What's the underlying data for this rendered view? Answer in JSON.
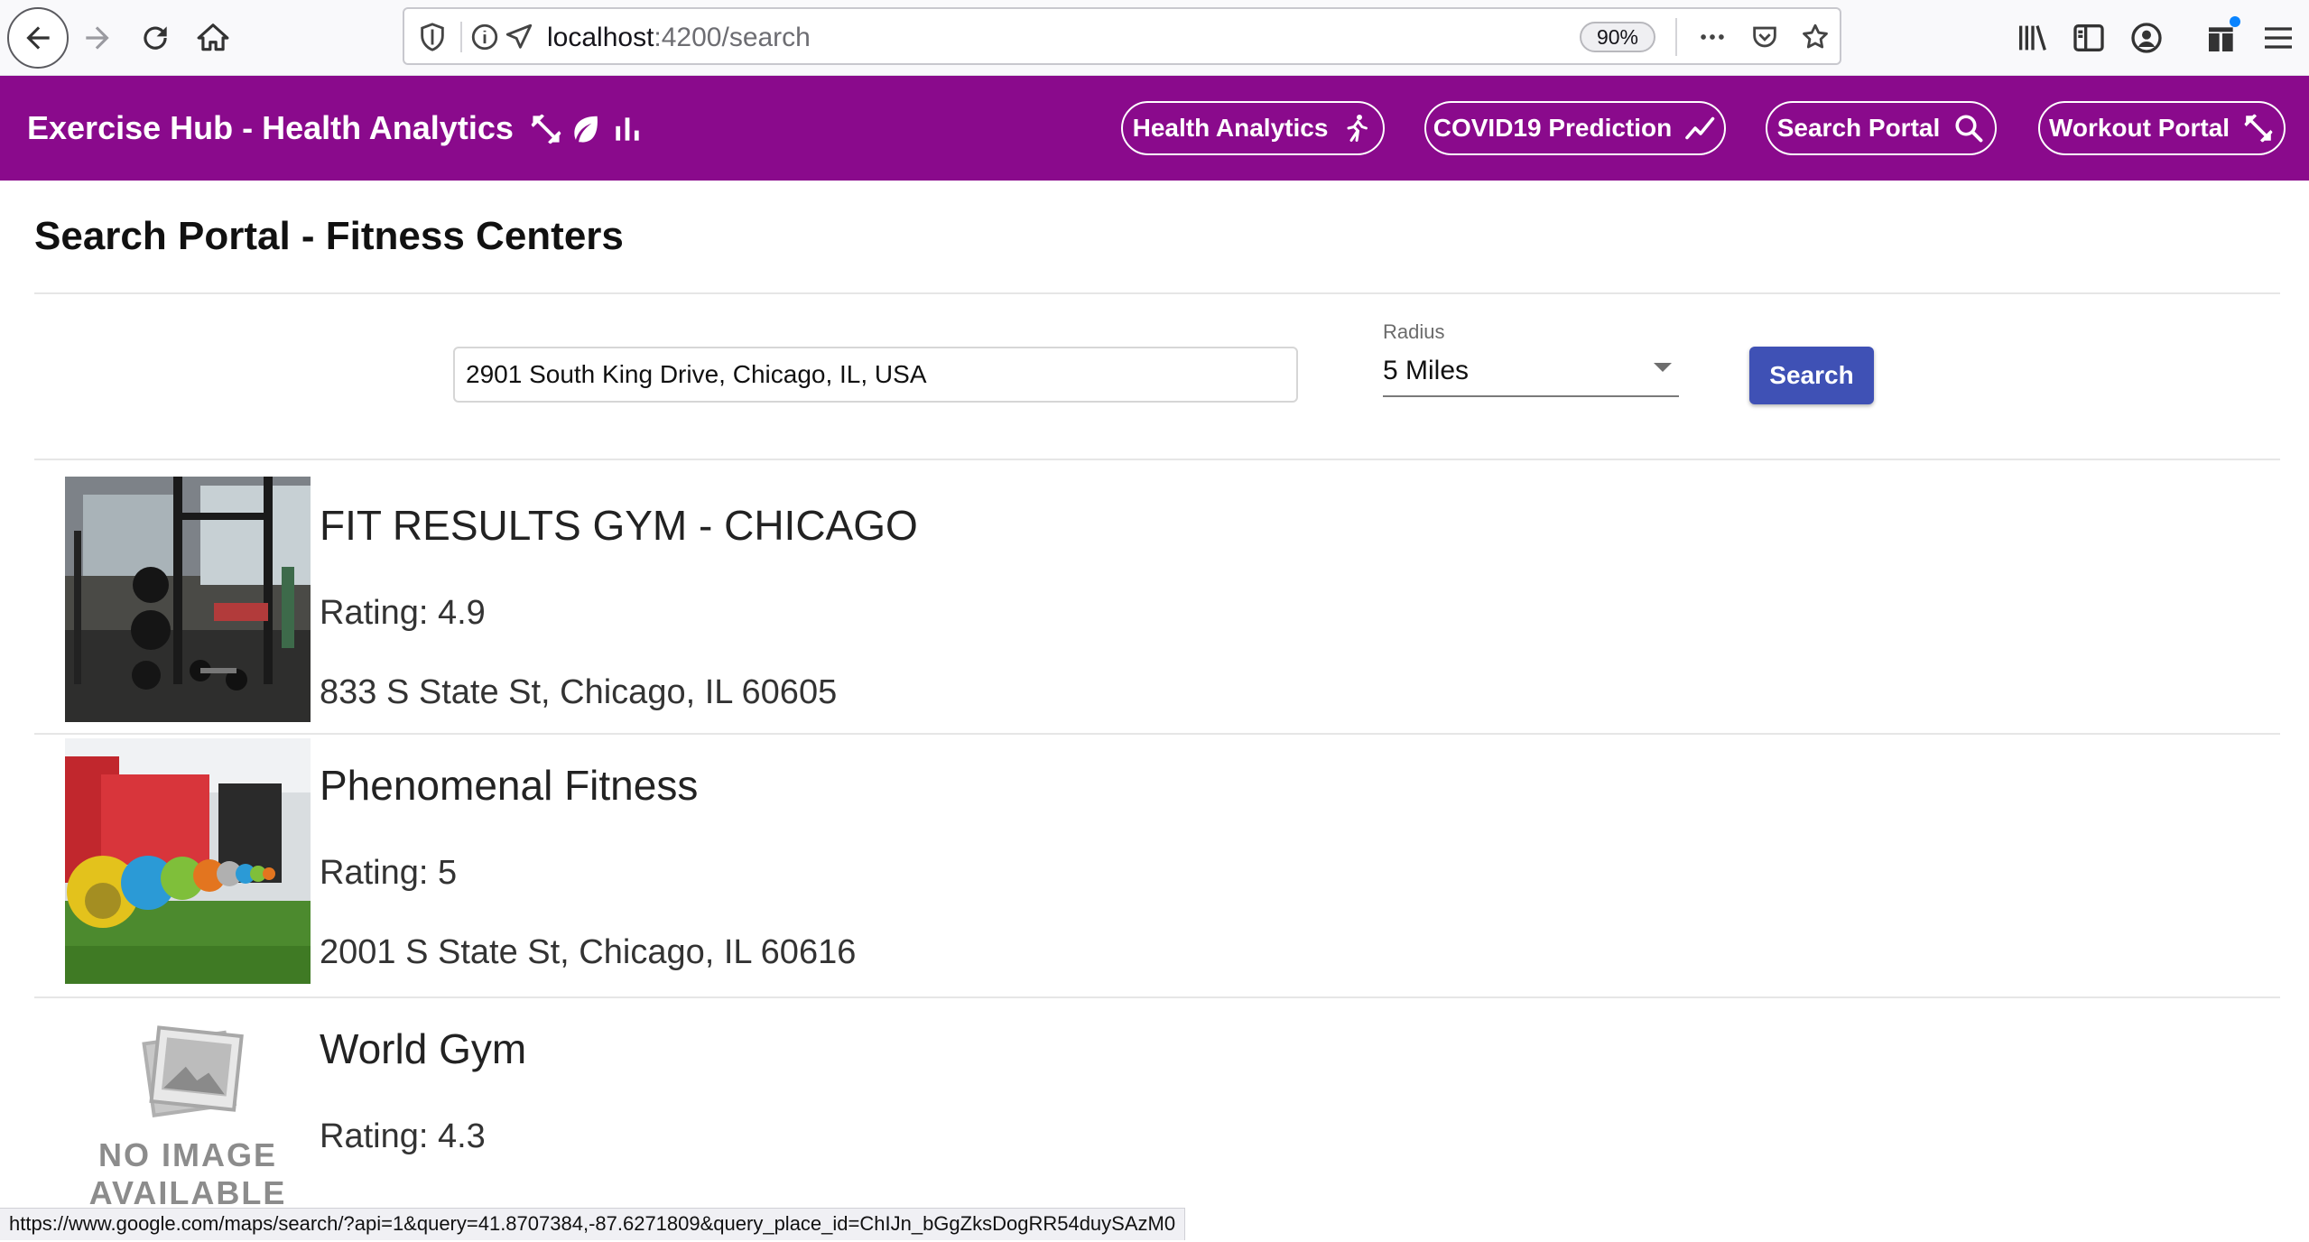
{
  "browser": {
    "url_host": "localhost",
    "url_rest": ":4200/search",
    "zoom": "90%",
    "status_url": "https://www.google.com/maps/search/?api=1&query=41.8707384,-87.6271809&query_place_id=ChIJn_bGgZksDogRR54duySAzM0"
  },
  "header": {
    "title": "Exercise Hub - Health Analytics",
    "nav": [
      {
        "label": "Health Analytics",
        "icon": "running-icon"
      },
      {
        "label": "COVID19 Prediction",
        "icon": "trending-up-icon"
      },
      {
        "label": "Search Portal",
        "icon": "search-icon"
      },
      {
        "label": "Workout Portal",
        "icon": "dumbbell-icon"
      }
    ],
    "background": "#8a0a8c"
  },
  "page": {
    "title": "Search Portal - Fitness Centers"
  },
  "search": {
    "location_value": "2901 South King Drive, Chicago, IL, USA",
    "radius_label": "Radius",
    "radius_value": "5 Miles",
    "button_label": "Search",
    "button_color": "#3f51b5"
  },
  "results": [
    {
      "name": "FIT RESULTS GYM - CHICAGO",
      "rating": "Rating: 4.9",
      "address": "833 S State St, Chicago, IL 60605",
      "image": "gym-interior-photo"
    },
    {
      "name": "Phenomenal Fitness",
      "rating": "Rating: 5",
      "address": "2001 S State St, Chicago, IL 60616",
      "image": "kettlebells-photo"
    },
    {
      "name": "World Gym",
      "rating": "Rating: 4.3",
      "address": "",
      "image": "no-image-placeholder",
      "placeholder_lines": [
        "NO IMAGE",
        "AVAILABLE"
      ]
    }
  ]
}
